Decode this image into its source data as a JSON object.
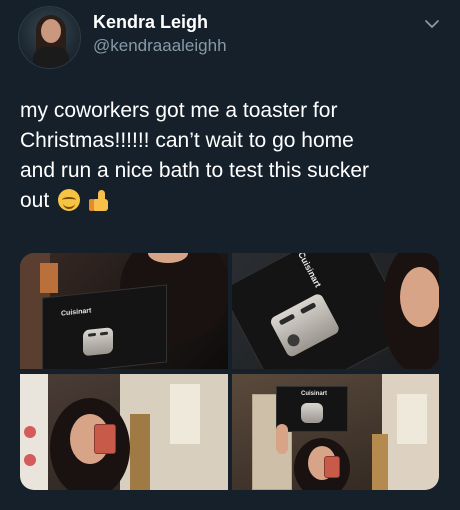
{
  "tweet": {
    "author": {
      "name": "Kendra Leigh",
      "handle": "@kendraaaleighh"
    },
    "text_lines": [
      "my coworkers got me a toaster for",
      "Christmas!!!!!! can’t wait to go home",
      "and run a nice bath to test this sucker",
      "out"
    ],
    "emojis": [
      "smiling-blush-emoji",
      "thumbs-up-emoji"
    ],
    "media": {
      "photos": [
        {
          "name": "photo-box-held",
          "box_label": "Cuisinart"
        },
        {
          "name": "photo-box-closeup",
          "box_label": "Cuisinart"
        },
        {
          "name": "photo-mirror-selfie-1"
        },
        {
          "name": "photo-mirror-selfie-2",
          "box_label": "Cuisinart"
        }
      ]
    }
  },
  "colors": {
    "background": "#15202b",
    "primary_text": "#ffffff",
    "secondary_text": "#8899a6"
  },
  "icons": {
    "menu": "chevron-down-icon"
  }
}
